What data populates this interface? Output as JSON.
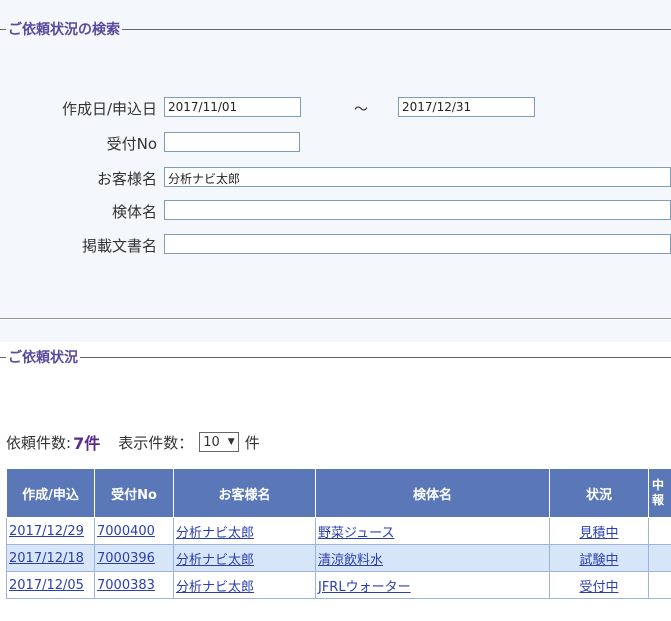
{
  "search": {
    "legend": "ご依頼状況の検索",
    "fields": {
      "date_label": "作成日/申込日",
      "date_from": "2017/11/01",
      "tilde": "～",
      "date_to": "2017/12/31",
      "receipt_label": "受付No",
      "receipt_value": "",
      "customer_label": "お客様名",
      "customer_value": "分析ナビ太郎",
      "sample_label": "検体名",
      "sample_value": "",
      "document_label": "掲載文書名",
      "document_value": ""
    }
  },
  "status": {
    "legend": "ご依頼状況",
    "count_label": "依頼件数:",
    "count_value": "7件",
    "display_label": "表示件数：",
    "display_value": "10",
    "display_unit": "件"
  },
  "table": {
    "headers": [
      "作成/申込",
      "受付No",
      "お客様名",
      "検体名",
      "状況",
      "中\n報"
    ],
    "rows": [
      {
        "date": "2017/12/29",
        "no": "7000400",
        "customer": "分析ナビ太郎",
        "sample": "野菜ジュース",
        "status": "見積中"
      },
      {
        "date": "2017/12/18",
        "no": "7000396",
        "customer": "分析ナビ太郎",
        "sample": "清涼飲料水",
        "status": "試験中"
      },
      {
        "date": "2017/12/05",
        "no": "7000383",
        "customer": "分析ナビ太郎",
        "sample": "JFRLウォーター",
        "status": "受付中"
      }
    ]
  },
  "colors": {
    "header_bg": "#5a78b8",
    "legend_text": "#5a4a9e",
    "row_alt": "#d6e6f8",
    "link": "#2a3fb0"
  }
}
